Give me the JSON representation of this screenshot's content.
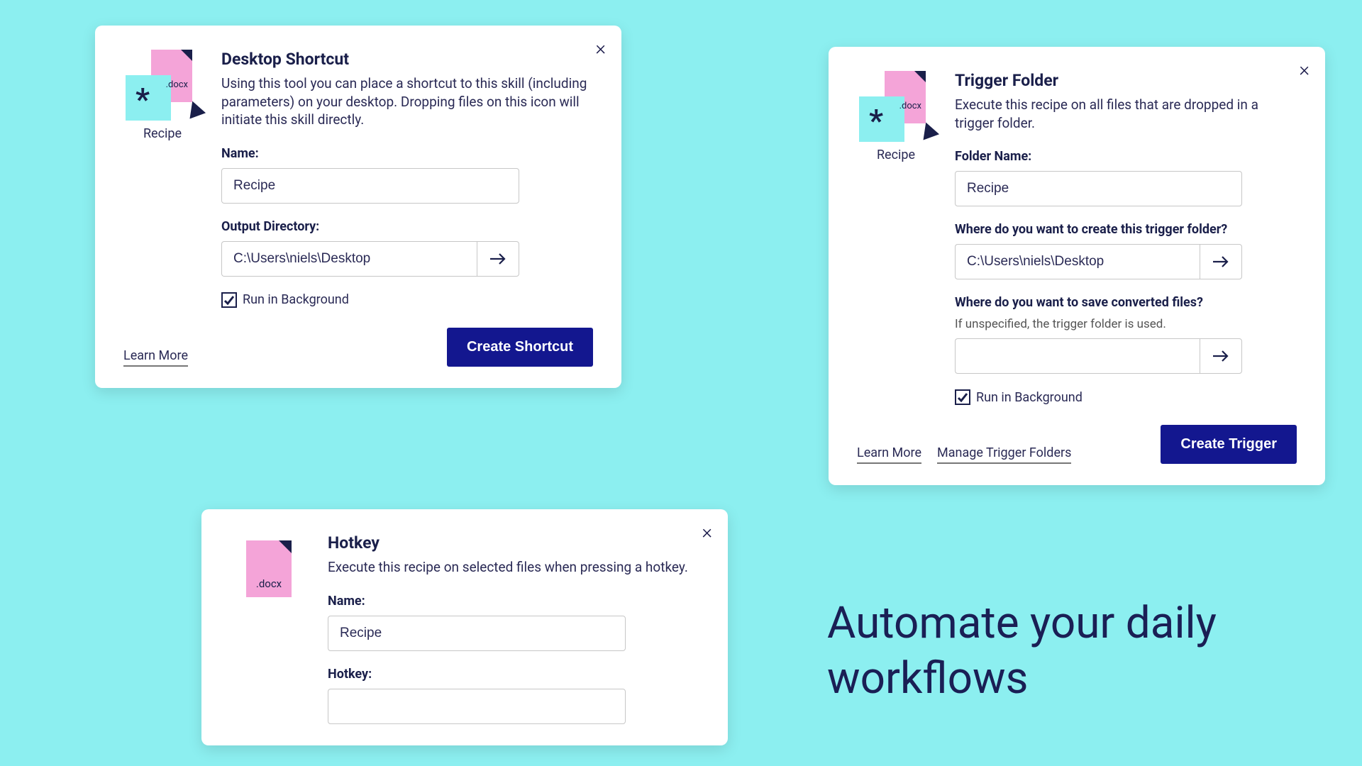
{
  "headline": "Automate your daily workflows",
  "shortcut": {
    "title": "Desktop Shortcut",
    "desc": "Using this tool you can place a shortcut to this skill (including parameters) on your desktop. Dropping files on this icon will initiate this skill directly.",
    "icon_caption": "Recipe",
    "name_label": "Name:",
    "name_value": "Recipe",
    "outdir_label": "Output Directory:",
    "outdir_value": "C:\\Users\\niels\\Desktop",
    "run_bg_label": "Run in Background",
    "run_bg_checked": true,
    "learn_more": "Learn More",
    "create_btn": "Create Shortcut"
  },
  "trigger": {
    "title": "Trigger Folder",
    "desc": "Execute this recipe on all files that are dropped in a trigger folder.",
    "icon_caption": "Recipe",
    "folder_label": "Folder Name:",
    "folder_value": "Recipe",
    "where_create_label": "Where do you want to create this trigger folder?",
    "where_create_value": "C:\\Users\\niels\\Desktop",
    "where_save_label": "Where do you want to save converted files?",
    "where_save_sub": "If unspecified, the trigger folder is used.",
    "where_save_value": "",
    "run_bg_label": "Run in Background",
    "run_bg_checked": true,
    "learn_more": "Learn More",
    "manage": "Manage Trigger Folders",
    "create_btn": "Create Trigger"
  },
  "hotkey": {
    "title": "Hotkey",
    "desc": "Execute this recipe on selected files when pressing a hotkey.",
    "name_label": "Name:",
    "name_value": "Recipe",
    "hotkey_label": "Hotkey:",
    "hotkey_value": ""
  }
}
